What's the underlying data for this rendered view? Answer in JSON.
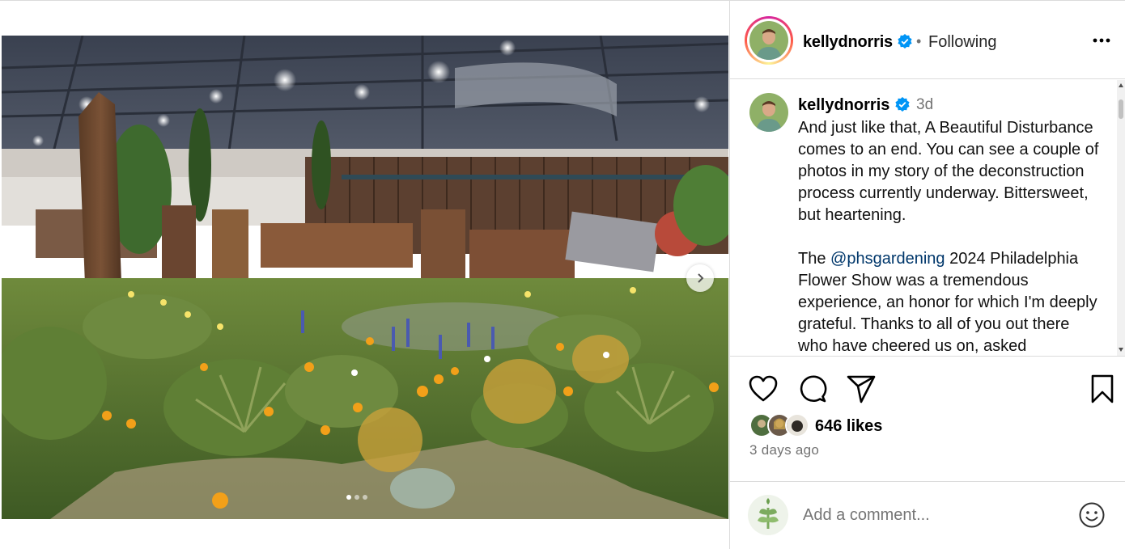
{
  "post": {
    "username": "kellydnorris",
    "follow_status": "Following",
    "separator": "•",
    "caption_time": "3d",
    "caption_paragraphs": [
      {
        "text": "And just like that, A Beautiful Disturbance comes to an end. You can see a couple of photos in my story of the deconstruction process currently underway. Bittersweet, but heartening."
      },
      {
        "before": "The ",
        "mention": "@phsgardening",
        "after": " 2024 Philadelphia Flower Show was a tremendous experience, an honor for which I'm deeply grateful. Thanks to all of you out there who have cheered us on, asked"
      }
    ],
    "likes": "646 likes",
    "posted_ago": "3 days ago",
    "comment_placeholder": "Add a comment...",
    "carousel": {
      "total_slides": 3,
      "active_index": 0
    }
  },
  "colors": {
    "verified_blue": "#0095f6",
    "mention_blue": "#00376b",
    "secondary_text": "#737373",
    "border": "#dbdbdb"
  },
  "icons": [
    "more-options-icon",
    "verified-badge-icon",
    "heart-icon",
    "comment-icon",
    "share-icon",
    "bookmark-icon",
    "emoji-icon",
    "next-arrow-icon"
  ]
}
